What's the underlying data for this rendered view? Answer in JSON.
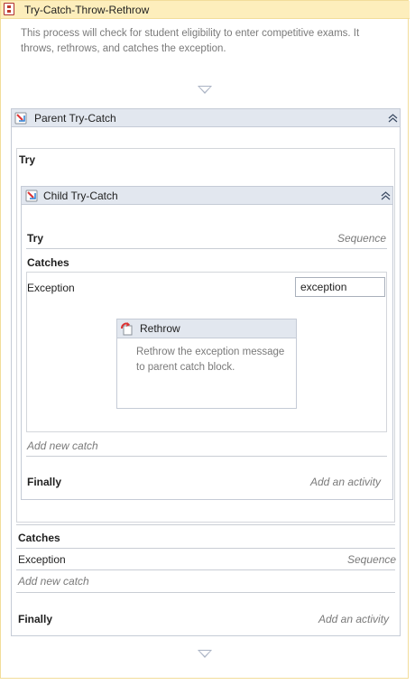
{
  "sequence": {
    "title": "Try-Catch-Throw-Rethrow",
    "description": "This process will check for student eligibility to enter competitive exams. It throws, rethrows, and catches the exception."
  },
  "parent": {
    "title": "Parent Try-Catch",
    "try_label": "Try",
    "catches_label": "Catches",
    "exception_type": "Exception",
    "exception_handler": "Sequence",
    "add_catch": "Add new catch",
    "finally_label": "Finally",
    "finally_hint": "Add an activity"
  },
  "child": {
    "title": "Child Try-Catch",
    "try_label": "Try",
    "try_hint": "Sequence",
    "catches_label": "Catches",
    "exception_type": "Exception",
    "exception_var": "exception",
    "add_catch": "Add new catch",
    "finally_label": "Finally",
    "finally_hint": "Add an activity"
  },
  "rethrow": {
    "title": "Rethrow",
    "description": "Rethrow the exception message to  parent catch block."
  },
  "icons": {
    "sequence": "sequence-icon",
    "trycatch": "try-catch-icon",
    "rethrow": "rethrow-icon",
    "collapse": "collapse-icon",
    "drop_arrow": "drop-arrow-icon"
  }
}
